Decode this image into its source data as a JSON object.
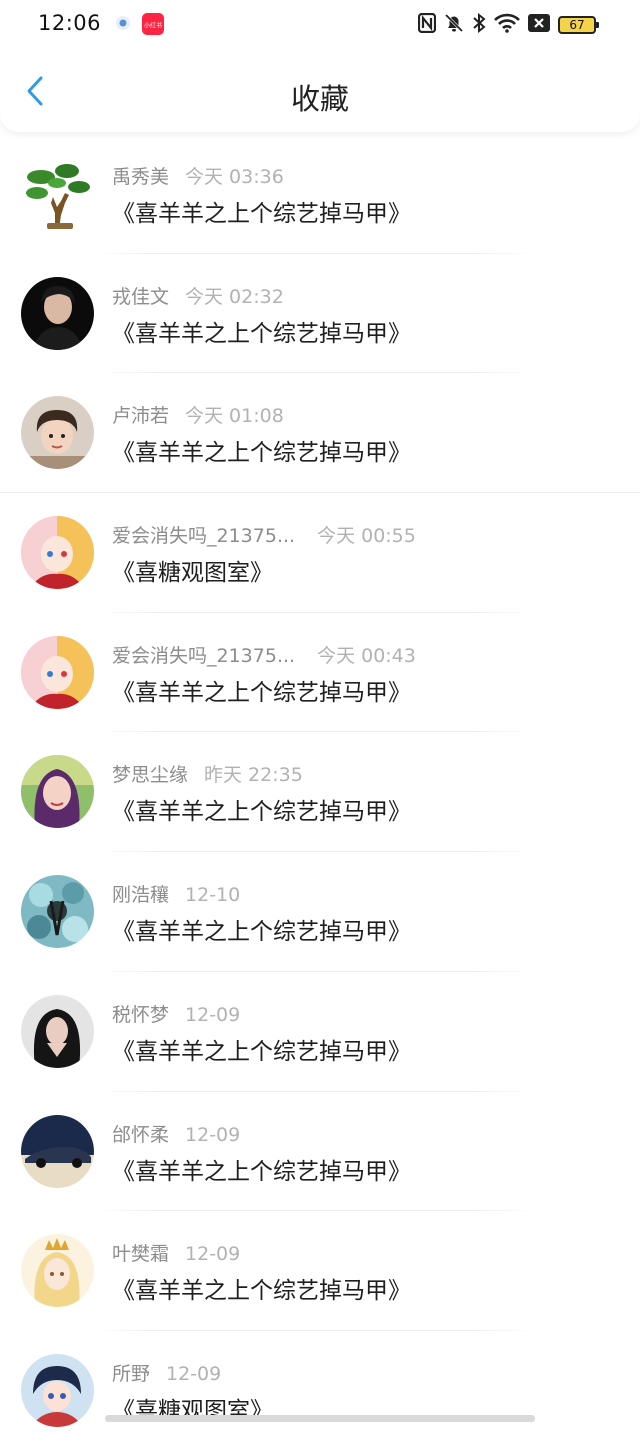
{
  "status_bar": {
    "time": "12:06",
    "app_badge": "小红书",
    "battery": "67",
    "icons": [
      "settings-dot-icon",
      "nfc-icon",
      "bell-off-icon",
      "bluetooth-icon",
      "wifi-icon",
      "no-sim-icon",
      "battery-icon"
    ]
  },
  "header": {
    "title": "收藏",
    "back_icon": "chevron-left-icon",
    "accent": "#2f9be8"
  },
  "items": [
    {
      "name": "禹秀美",
      "time": "今天 03:36",
      "content": "《喜羊羊之上个综艺掉马甲》",
      "avatar": "bonsai-tree"
    },
    {
      "name": "戎佳文",
      "time": "今天 02:32",
      "content": "《喜羊羊之上个综艺掉马甲》",
      "avatar": "dark-portrait"
    },
    {
      "name": "卢沛若",
      "time": "今天 01:08",
      "content": "《喜羊羊之上个综艺掉马甲》",
      "avatar": "child-photo"
    },
    {
      "name": "爱会消失吗_21375...",
      "time": "今天 00:55",
      "content": "《喜糖观图室》",
      "avatar": "anime-girl-pink"
    },
    {
      "name": "爱会消失吗_21375...",
      "time": "今天 00:43",
      "content": "《喜羊羊之上个综艺掉马甲》",
      "avatar": "anime-girl-pink"
    },
    {
      "name": "梦思尘缘",
      "time": "昨天 22:35",
      "content": "《喜羊羊之上个综艺掉马甲》",
      "avatar": "woman-portrait"
    },
    {
      "name": "刚浩穰",
      "time": "12-10",
      "content": "《喜羊羊之上个综艺掉马甲》",
      "avatar": "blue-flowers"
    },
    {
      "name": "税怀梦",
      "time": "12-09",
      "content": "《喜羊羊之上个综艺掉马甲》",
      "avatar": "girl-hands-face"
    },
    {
      "name": "邰怀柔",
      "time": "12-09",
      "content": "《喜羊羊之上个综艺掉马甲》",
      "avatar": "sports-car"
    },
    {
      "name": "叶樊霜",
      "time": "12-09",
      "content": "《喜羊羊之上个综艺掉马甲》",
      "avatar": "anime-crown"
    },
    {
      "name": "所野",
      "time": "12-09",
      "content": "《喜糖观图室》",
      "avatar": "anime-boy"
    }
  ]
}
